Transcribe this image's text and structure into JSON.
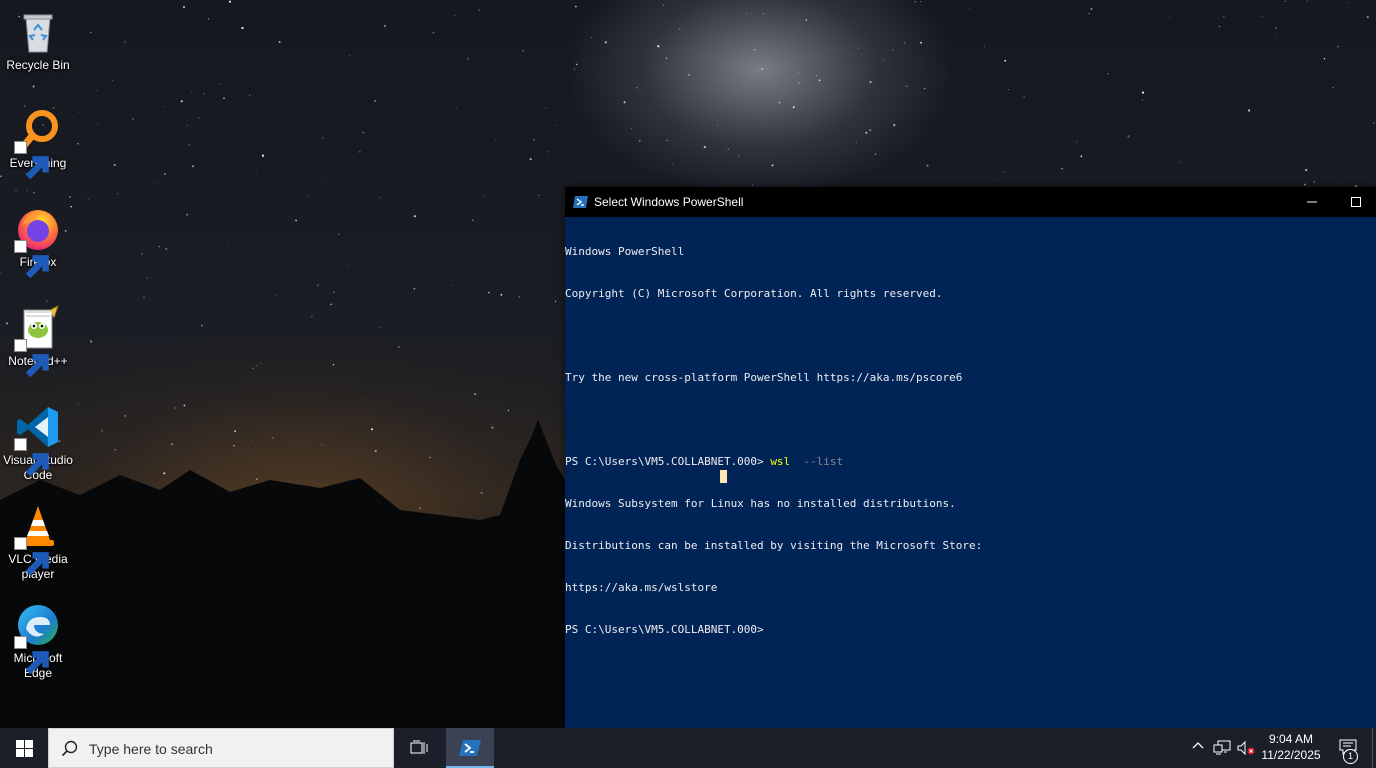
{
  "desktop": {
    "icons": [
      {
        "label": "Recycle Bin",
        "icon": "recycle-bin-icon"
      },
      {
        "label": "Everything",
        "icon": "everything-search-icon"
      },
      {
        "label": "Firefox",
        "icon": "firefox-icon"
      },
      {
        "label": "Notepad++",
        "icon": "notepad-plus-plus-icon"
      },
      {
        "label": "Visual Studio Code",
        "icon": "vscode-icon"
      },
      {
        "label": "VLC media player",
        "icon": "vlc-icon"
      },
      {
        "label": "Microsoft Edge",
        "icon": "edge-icon"
      }
    ]
  },
  "powershell": {
    "title": "Select Windows PowerShell",
    "lines": {
      "l1": "Windows PowerShell",
      "l2": "Copyright (C) Microsoft Corporation. All rights reserved.",
      "l3": "Try the new cross-platform PowerShell https://aka.ms/pscore6",
      "prompt": "PS C:\\Users\\VM5.COLLABNET.000> ",
      "cmd": "wsl",
      "param": "  --list",
      "l5": "Windows Subsystem for Linux has no installed distributions.",
      "l6": "Distributions can be installed by visiting the Microsoft Store:",
      "l7": "https://aka.ms/wslstore",
      "l8": "PS C:\\Users\\VM5.COLLABNET.000>"
    }
  },
  "taskbar": {
    "search_placeholder": "Type here to search",
    "clock_time": "9:04 AM",
    "clock_date": "11/22/2025",
    "notification_count": "1"
  },
  "colors": {
    "console_bg": "#012456",
    "console_text": "#eeedf0",
    "command": "#ffff00",
    "parameter": "#8a8a8a",
    "taskbar": "#1a1f2a"
  }
}
